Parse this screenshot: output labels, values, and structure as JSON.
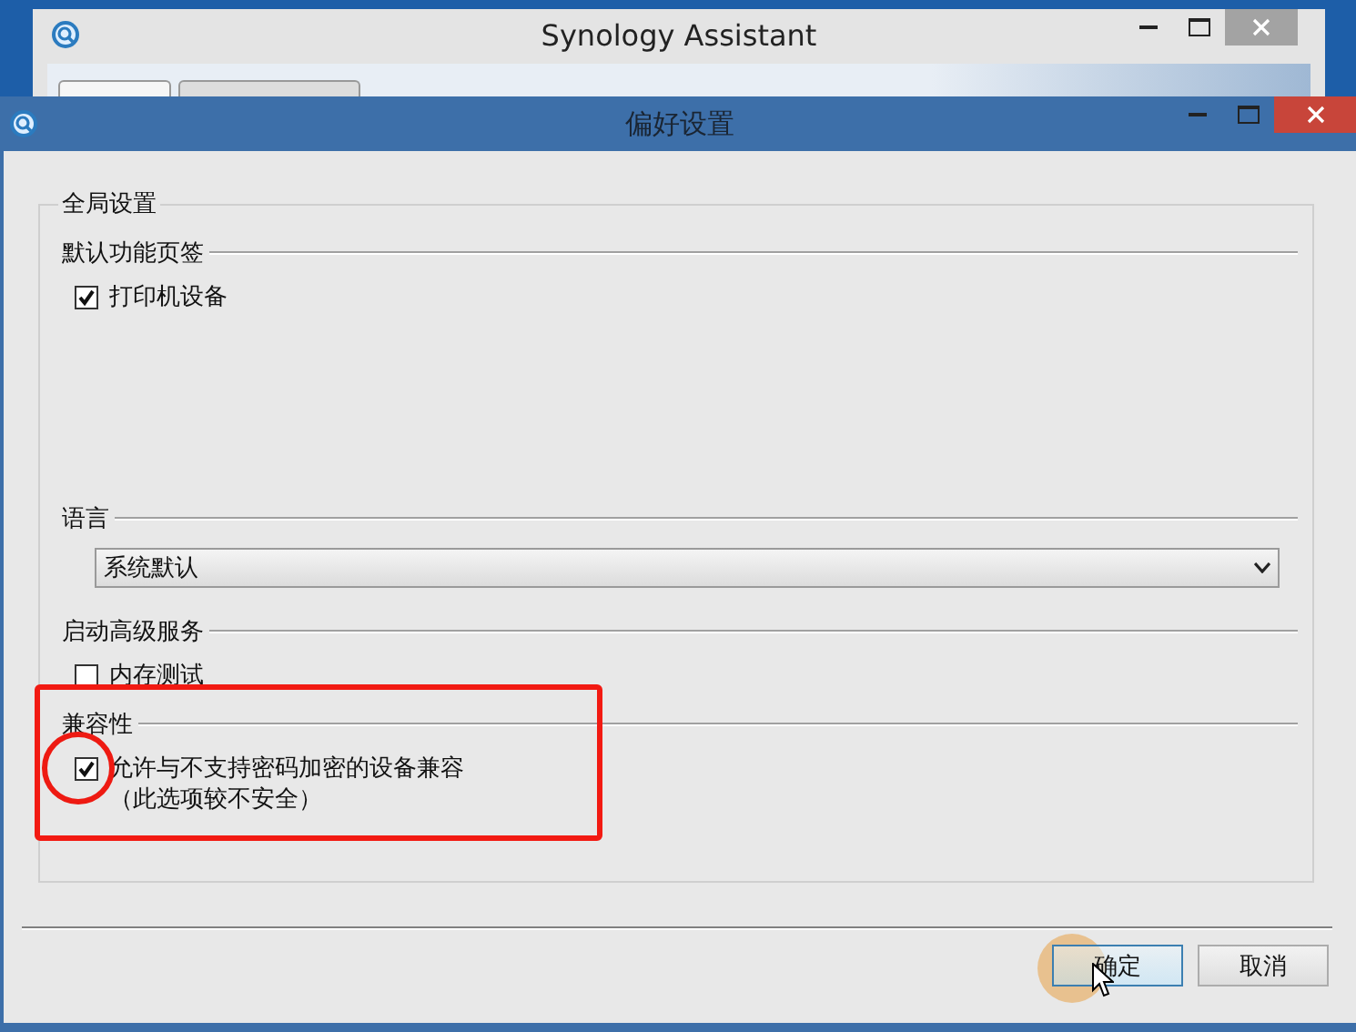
{
  "background_window": {
    "title": "Synology Assistant"
  },
  "dialog": {
    "title": "偏好设置",
    "group": {
      "title": "全局设置",
      "sections": [
        {
          "kind": "checkboxes",
          "title": "默认功能页签",
          "items": [
            {
              "label": "打印机设备",
              "checked": true,
              "circled": false
            }
          ],
          "highlighted": false
        },
        {
          "kind": "select",
          "title": "语言",
          "value": "系统默认",
          "highlighted": false
        },
        {
          "kind": "checkboxes",
          "title": "启动高级服务",
          "items": [
            {
              "label": "内存测试",
              "checked": false,
              "circled": false
            }
          ],
          "highlighted": false
        },
        {
          "kind": "checkboxes",
          "title": "兼容性",
          "items": [
            {
              "label": "允许与不支持密码加密的设备兼容",
              "note": "（此选项较不安全）",
              "checked": true,
              "circled": true
            }
          ],
          "highlighted": true
        }
      ]
    },
    "buttons": [
      {
        "label": "确定",
        "default": true,
        "pointer": true
      },
      {
        "label": "取消",
        "default": false,
        "pointer": false
      }
    ]
  }
}
